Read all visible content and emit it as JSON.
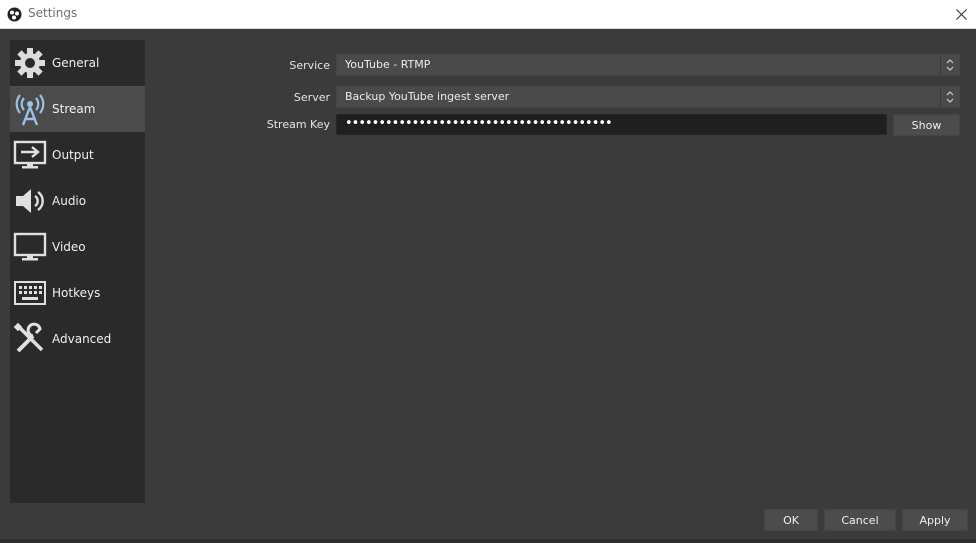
{
  "window": {
    "title": "Settings",
    "app_icon": "obs-icon",
    "close_icon": "close-icon"
  },
  "sidebar": {
    "items": [
      {
        "label": "General",
        "icon": "gear-icon",
        "active": false
      },
      {
        "label": "Stream",
        "icon": "broadcast-tower-icon",
        "active": true
      },
      {
        "label": "Output",
        "icon": "monitor-output-icon",
        "active": false
      },
      {
        "label": "Audio",
        "icon": "speaker-icon",
        "active": false
      },
      {
        "label": "Video",
        "icon": "monitor-icon",
        "active": false
      },
      {
        "label": "Hotkeys",
        "icon": "keyboard-icon",
        "active": false
      },
      {
        "label": "Advanced",
        "icon": "tools-icon",
        "active": false
      }
    ]
  },
  "stream": {
    "service_label": "Service",
    "service_value": "YouTube - RTMP",
    "server_label": "Server",
    "server_value": "Backup YouTube ingest server",
    "key_label": "Stream Key",
    "key_masked": "••••••••••••••••••••••••••••••••••••••••",
    "show_button": "Show"
  },
  "footer": {
    "ok": "OK",
    "cancel": "Cancel",
    "apply": "Apply"
  },
  "colors": {
    "background": "#3b3b3b",
    "sidebar": "#2a2a2a",
    "active_item": "#4b4b4b",
    "field": "#4a4a4a",
    "key_field": "#1f1f1f"
  }
}
